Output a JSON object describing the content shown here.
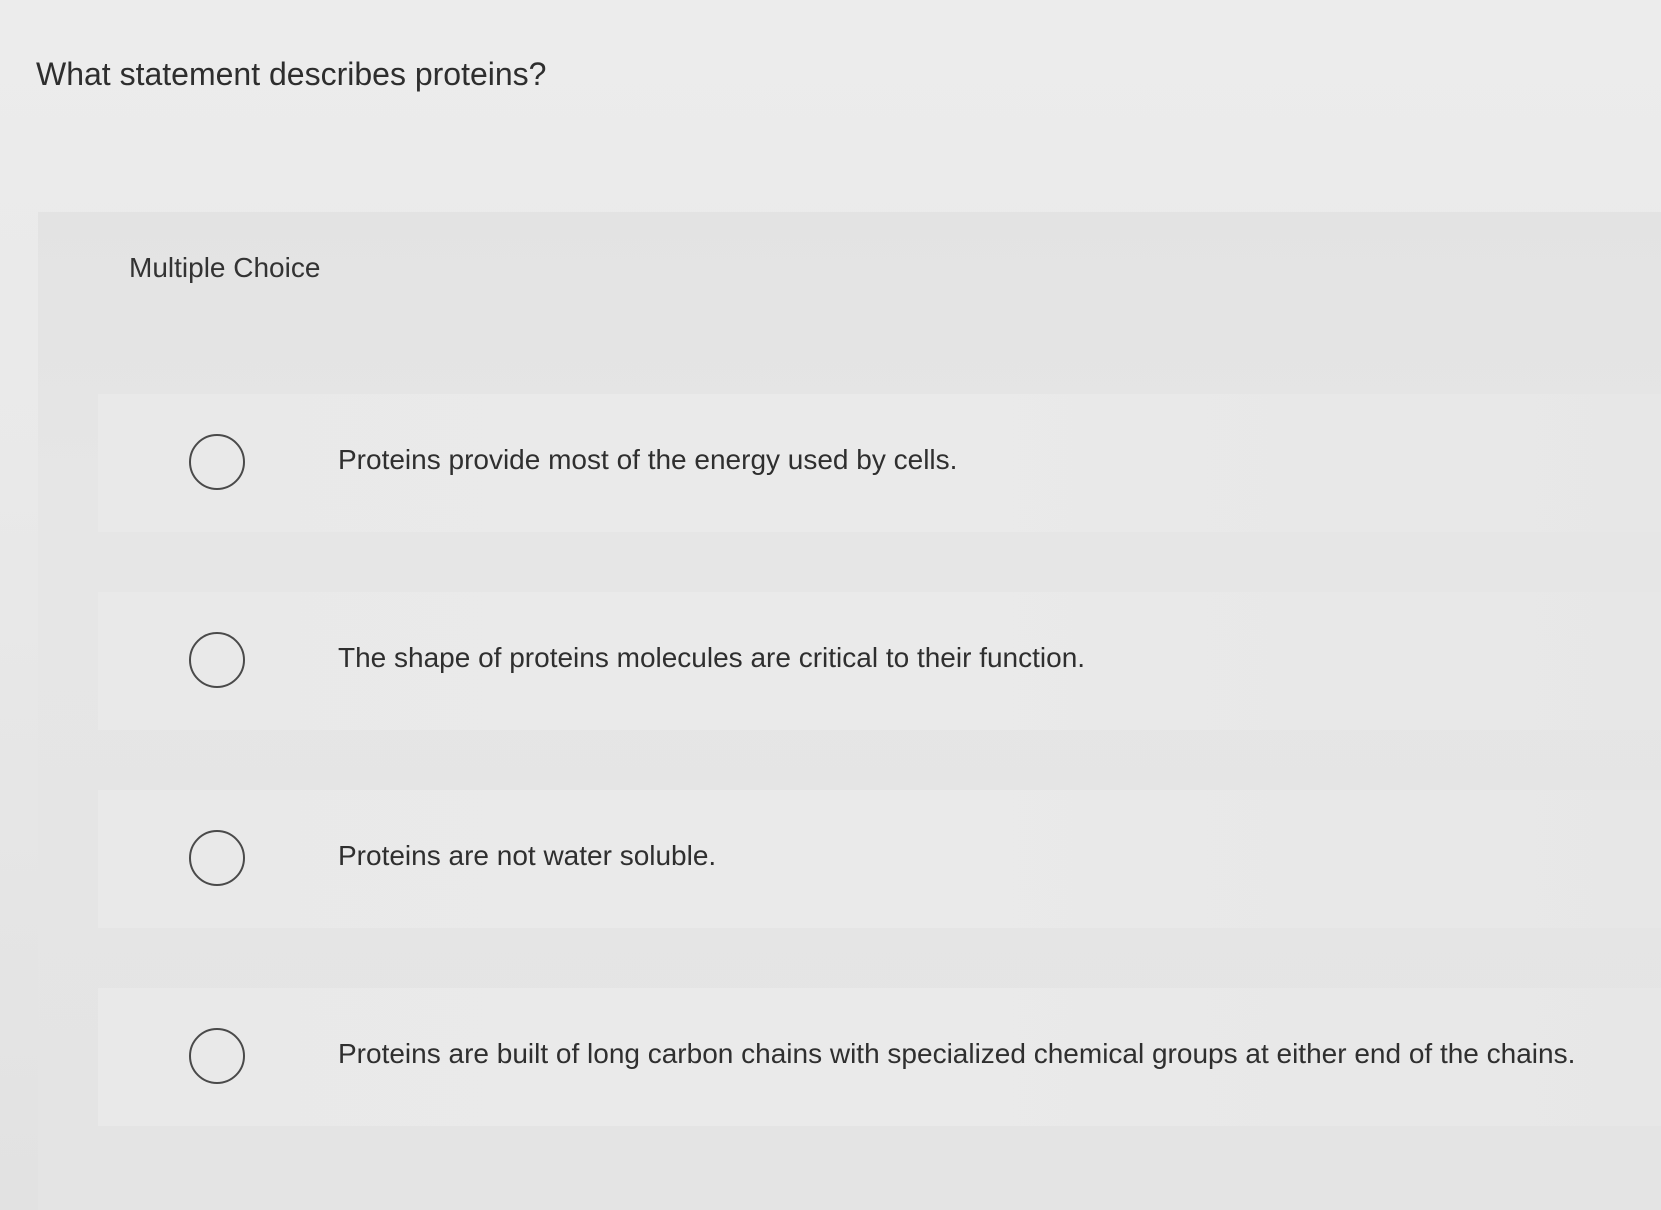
{
  "question": {
    "text": "What statement describes proteins?"
  },
  "panel": {
    "label": "Multiple Choice"
  },
  "choices": [
    {
      "text": "Proteins provide most of the energy used by cells.",
      "selected": false
    },
    {
      "text": "The shape of proteins molecules are critical to their function.",
      "selected": false
    },
    {
      "text": "Proteins are not water soluble.",
      "selected": false
    },
    {
      "text": "Proteins are built of long carbon chains with specialized chemical groups at either end of the chains.",
      "selected": false
    }
  ],
  "icons": {
    "radio": "radio-unchecked-icon"
  },
  "colors": {
    "text": "#2f2f2f",
    "radio_border": "#4a4a4a",
    "background": "#ececec"
  }
}
